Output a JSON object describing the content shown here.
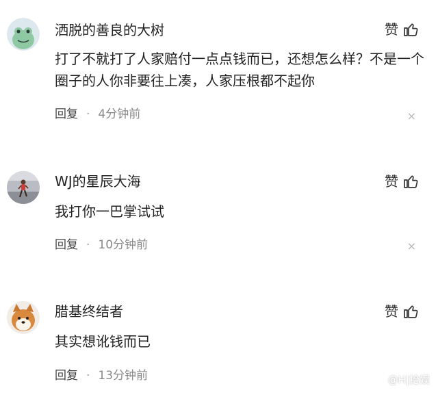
{
  "comments": [
    {
      "username": "洒脱的善良的大树",
      "avatar_icon": "frog-avatar-icon",
      "like_label": "赞",
      "text": "打了不就打了人家赔付一点点钱而已，还想怎么样？不是一个圈子的人你非要往上凑，人家压根都不起你",
      "reply_label": "回复",
      "separator": "·",
      "time": "4分钟前",
      "close_glyph": "×"
    },
    {
      "username": "WJ的星辰大海",
      "avatar_icon": "runner-avatar-icon",
      "like_label": "赞",
      "text": "我打你一巴掌试试",
      "reply_label": "回复",
      "separator": "·",
      "time": "10分钟前",
      "close_glyph": "×"
    },
    {
      "username": "腊基终结者",
      "avatar_icon": "shiba-dog-avatar-icon",
      "like_label": "赞",
      "text": "其实想讹钱而已",
      "reply_label": "回复",
      "separator": "·",
      "time": "13分钟前",
      "close_glyph": ""
    }
  ],
  "watermark": {
    "text": "@H|拾娱",
    "icon": "headline-logo-icon"
  },
  "colors": {
    "text_primary": "#222222",
    "text_secondary": "#888888",
    "background": "#ffffff"
  }
}
